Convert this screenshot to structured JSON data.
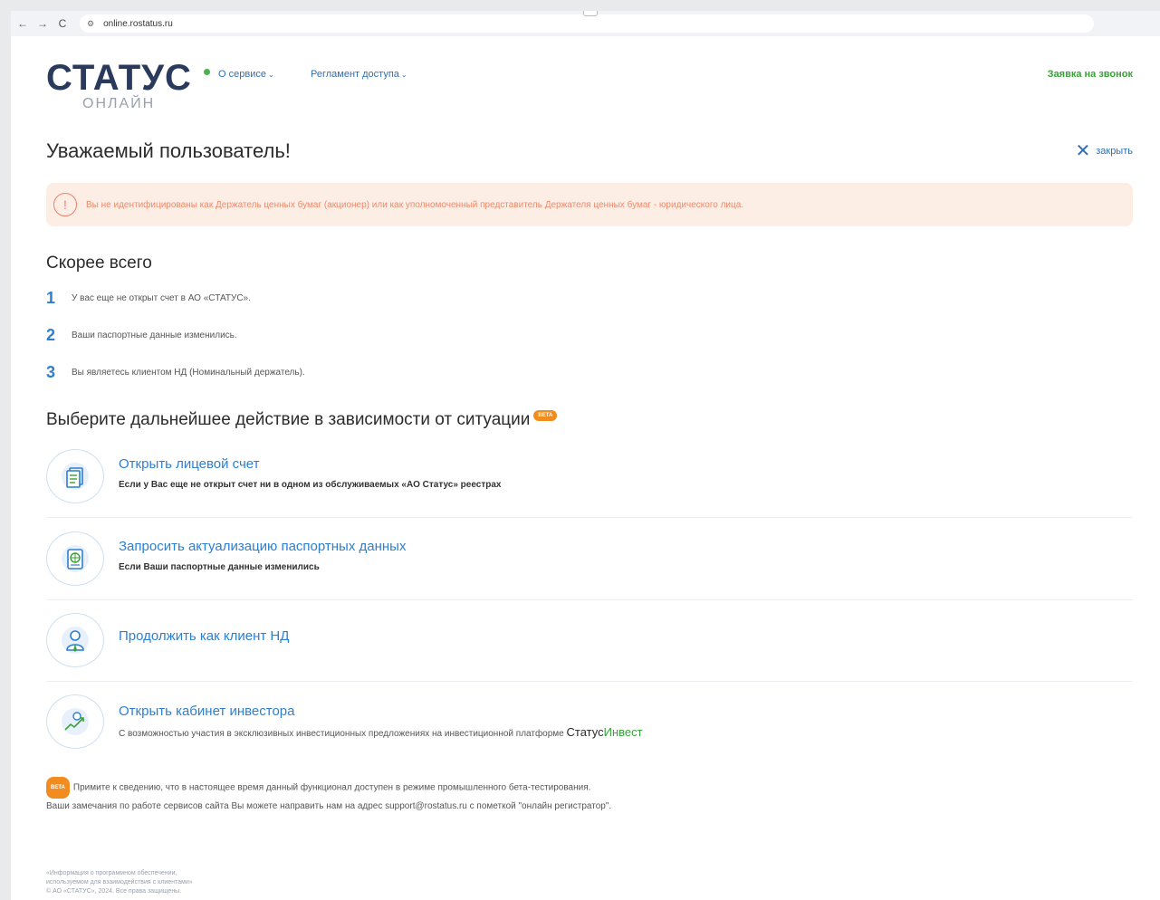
{
  "browser": {
    "url": "online.rostatus.ru",
    "back_icon": "←",
    "forward_icon": "→",
    "reload_icon": "C",
    "site_icon": "⚙"
  },
  "header": {
    "logo_main": "СТАТУС",
    "logo_sub": "ОНЛАЙН",
    "menu_about": "О сервисе",
    "menu_rules": "Регламент доступа",
    "callback": "Заявка на звонок"
  },
  "page": {
    "title": "Уважаемый пользователь!",
    "close_label": "закрыть",
    "alert_text": "Вы не идентифицированы как Держатель ценных бумаг (акционер) или как уполномоченный представитель Держателя ценных бумаг - юридического лица."
  },
  "likely": {
    "heading": "Скорее всего",
    "reasons": [
      {
        "num": "1",
        "text": "У вас еще не открыт счет в АО «СТАТУС»."
      },
      {
        "num": "2",
        "text": "Ваши паспортные данные изменились."
      },
      {
        "num": "3",
        "text": "Вы являетесь клиентом НД (Номинальный держатель)."
      }
    ]
  },
  "choose": {
    "heading": "Выберите дальнейшее действие в зависимости от ситуации",
    "beta": "BETA",
    "actions": [
      {
        "title": "Открыть лицевой счет",
        "desc": "Если у Вас еще не открыт счет ни в одном из обслуживаемых «АО Статус» реестрах",
        "icon": "document-icon"
      },
      {
        "title": "Запросить актуализацию паспортных данных",
        "desc": "Если Ваши паспортные данные изменились",
        "icon": "passport-icon"
      },
      {
        "title": "Продолжить как клиент НД",
        "desc": "",
        "icon": "user-icon"
      },
      {
        "title": "Открыть кабинет инвестора",
        "desc": "С возможностью участия в эксклюзивных инвестиционных предложениях на инвестиционной платформе",
        "brand_1": "Статус",
        "brand_2": "Инвест",
        "icon": "growth-chart-icon"
      }
    ]
  },
  "note": {
    "beta": "BETA",
    "line1": "Примите к сведению, что в настоящее время данный функционал доступен в режиме промышленного бета-тестирования.",
    "line2": "Ваши замечания по работе сервисов сайта Вы можете направить нам на адрес support@rostatus.ru с пометкой \"онлайн регистратор\"."
  },
  "footer": {
    "line1": "«Информация о программном обеспечении,",
    "line2": "используемом для взаимодействия с клиентами»",
    "line3": "© АО «СТАТУС», 2024. Все права защищены."
  },
  "colors": {
    "accent_blue": "#2e7fd0",
    "green": "#3aa03a",
    "alert_bg": "#fdeee5",
    "alert_text": "#ee8a6b",
    "beta_orange": "#f28c1e"
  }
}
